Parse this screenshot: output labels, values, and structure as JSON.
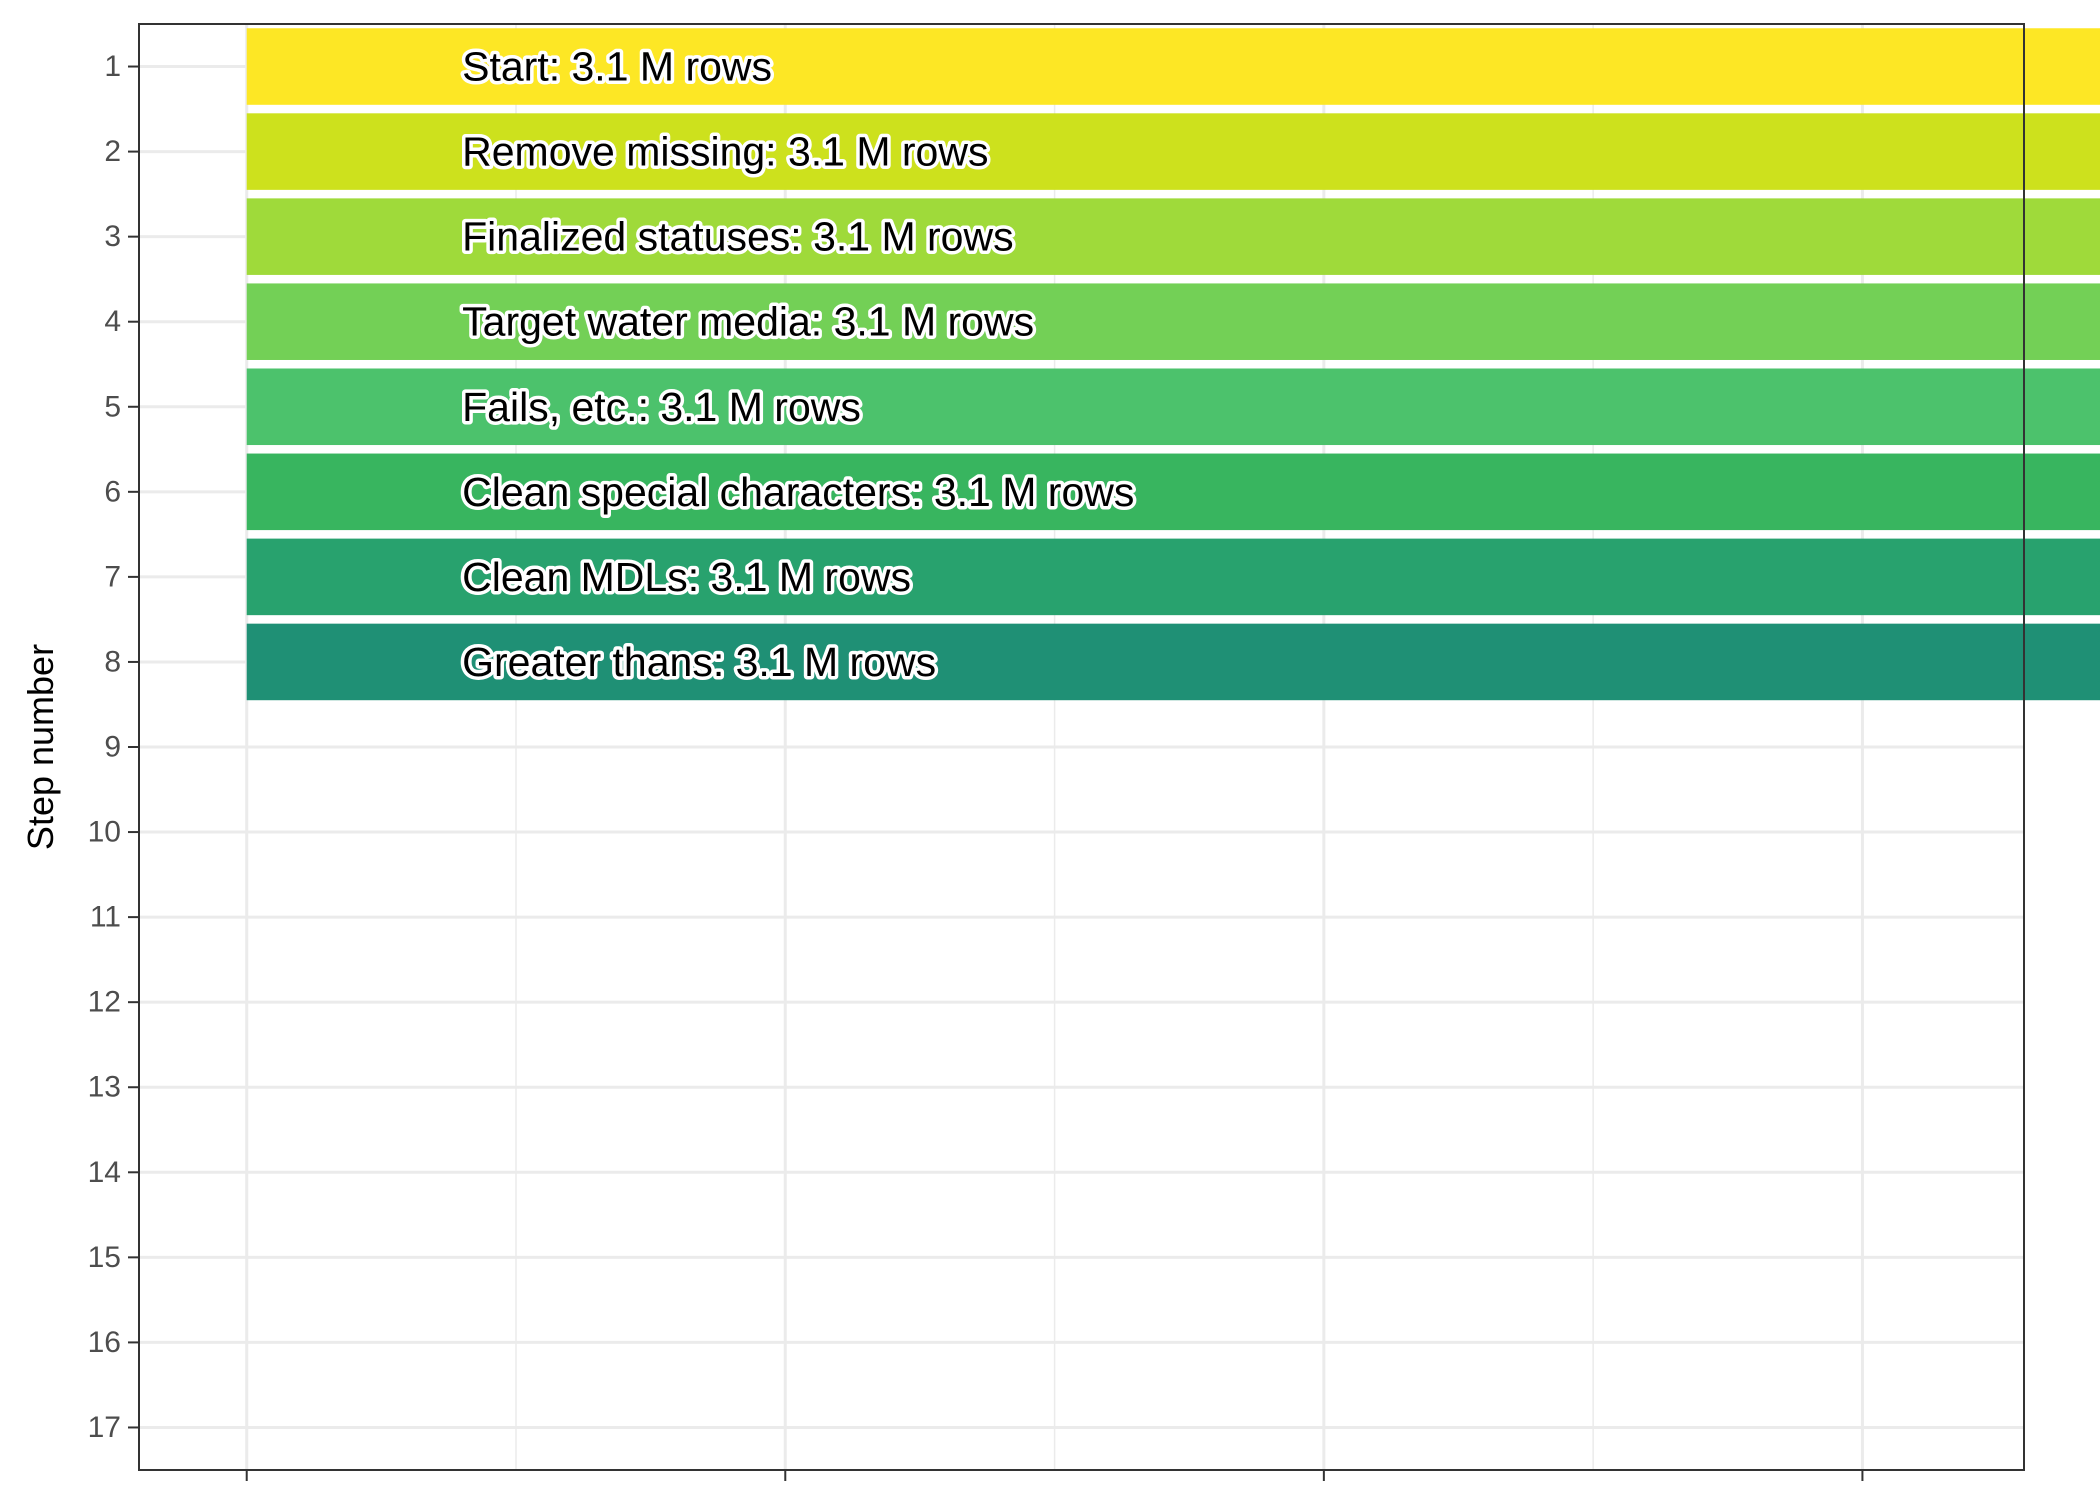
{
  "chart_data": {
    "type": "bar",
    "orientation": "horizontal",
    "title": "",
    "xlabel": "",
    "ylabel": "Step number",
    "grid": true,
    "legend": "none",
    "xlim": [
      -0.2,
      3.3
    ],
    "ylim": [
      0.5,
      17.5
    ],
    "x_major_ticks": [
      0,
      1,
      2,
      3,
      4
    ],
    "x_minor_ticks": [
      0.5,
      1.5,
      2.5,
      3.5
    ],
    "y_ticks": [
      1,
      2,
      3,
      4,
      5,
      6,
      7,
      8,
      9,
      10,
      11,
      12,
      13,
      14,
      15,
      16,
      17
    ],
    "steps": [
      1,
      2,
      3,
      4,
      5,
      6,
      7,
      8
    ],
    "values": [
      3.965,
      3.965,
      3.952,
      3.95,
      3.938,
      3.938,
      3.938,
      3.938
    ],
    "labels": [
      "Start:  3.1 M rows",
      "Remove missing:  3.1 M rows",
      "Finalized statuses:  3.1 M rows",
      "Target water media:  3.1 M rows",
      "Fails, etc.:  3.1 M rows",
      "Clean special characters:  3.1 M rows",
      "Clean MDLs:  3.1 M rows",
      "Greater thans:  3.1 M rows"
    ],
    "label_x": 0.4,
    "colors": [
      "#FDE725",
      "#CDE11D",
      "#9FDA3A",
      "#73D056",
      "#4CC26C",
      "#38B55F",
      "#28A26E",
      "#1F9075"
    ]
  }
}
